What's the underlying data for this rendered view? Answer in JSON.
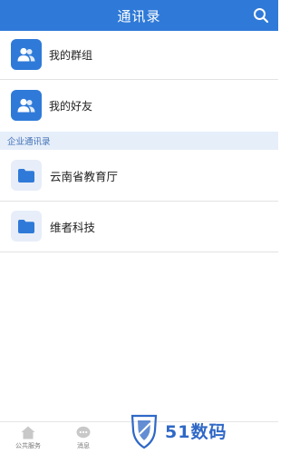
{
  "header": {
    "title": "通讯录",
    "search_icon": "search-icon"
  },
  "personal": [
    {
      "label": "我的群组",
      "icon": "group-icon"
    },
    {
      "label": "我的好友",
      "icon": "friends-icon"
    }
  ],
  "section": {
    "title": "企业通讯录"
  },
  "orgs": [
    {
      "label": "云南省教育厅",
      "icon": "folder-icon"
    },
    {
      "label": "维者科技",
      "icon": "folder-icon"
    }
  ],
  "bottom_nav": [
    {
      "label": "公共服务",
      "icon": "home-icon"
    },
    {
      "label": "消息",
      "icon": "message-icon"
    }
  ],
  "watermark": {
    "text": "51数码"
  },
  "colors": {
    "accent": "#2f7ad8",
    "section_bg": "#e6eefa",
    "folder_bg": "#e7eef9"
  }
}
